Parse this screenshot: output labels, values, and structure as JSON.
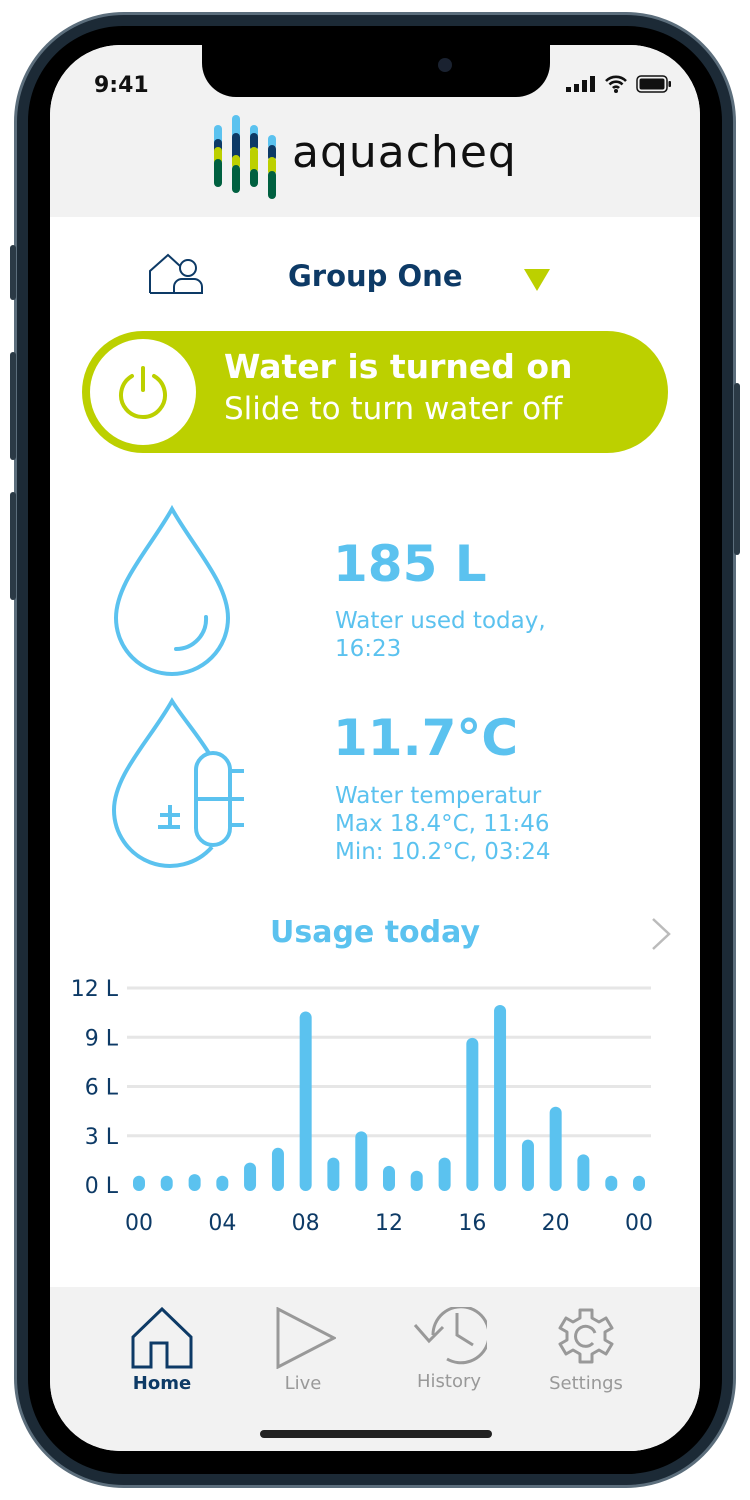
{
  "status_bar": {
    "time": "9:41"
  },
  "app": {
    "logo_text": "aquacheq",
    "brand_colors": [
      "#5bc2ef",
      "#0d3a66",
      "#bcd000",
      "#006040"
    ]
  },
  "group": {
    "name": "Group One",
    "icon": "group-user-icon",
    "dropdown_icon": "triangle-down-icon"
  },
  "water_switch": {
    "title": "Water is turned on",
    "subtitle": "Slide to turn water off",
    "icon": "power-icon",
    "state": "on",
    "color": "#bcd000"
  },
  "usage_stat": {
    "value": "185 L",
    "label_line1": "Water used today,",
    "label_line2": "16:23",
    "icon": "water-drop-icon"
  },
  "temperature_stat": {
    "value": "11.7°C",
    "label": "Water temperatur",
    "max": "Max 18.4°C, 11:46",
    "min": "Min: 10.2°C, 03:24",
    "icon": "drop-thermometer-icon"
  },
  "chart_section": {
    "title": "Usage today",
    "more_icon": "chevron-right-icon"
  },
  "chart_data": {
    "type": "bar",
    "title": "Usage today",
    "x": [
      0,
      1.33,
      2.67,
      4,
      5.33,
      6.67,
      8,
      9.33,
      10.67,
      12,
      13.33,
      14.67,
      16,
      17.33,
      18.67,
      20,
      21.33,
      22.67,
      24
    ],
    "values": [
      0.2,
      0.2,
      0.3,
      0.2,
      1.0,
      1.9,
      10.2,
      1.3,
      2.9,
      0.8,
      0.5,
      1.3,
      8.6,
      10.6,
      2.4,
      4.4,
      1.5,
      0.2,
      0.2
    ],
    "y_ticks": [
      "0 L",
      "3 L",
      "6 L",
      "9 L",
      "12 L"
    ],
    "x_ticks": [
      "00",
      "04",
      "08",
      "12",
      "16",
      "20",
      "00"
    ],
    "ylim": [
      0,
      12
    ],
    "xlim": [
      0,
      24
    ],
    "grid": true,
    "color": "#5bc2ef"
  },
  "nav": {
    "items": [
      {
        "label": "Home",
        "icon": "home-icon",
        "active": true
      },
      {
        "label": "Live",
        "icon": "play-icon",
        "active": false
      },
      {
        "label": "History",
        "icon": "history-icon",
        "active": false
      },
      {
        "label": "Settings",
        "icon": "gear-icon",
        "active": false
      }
    ]
  }
}
